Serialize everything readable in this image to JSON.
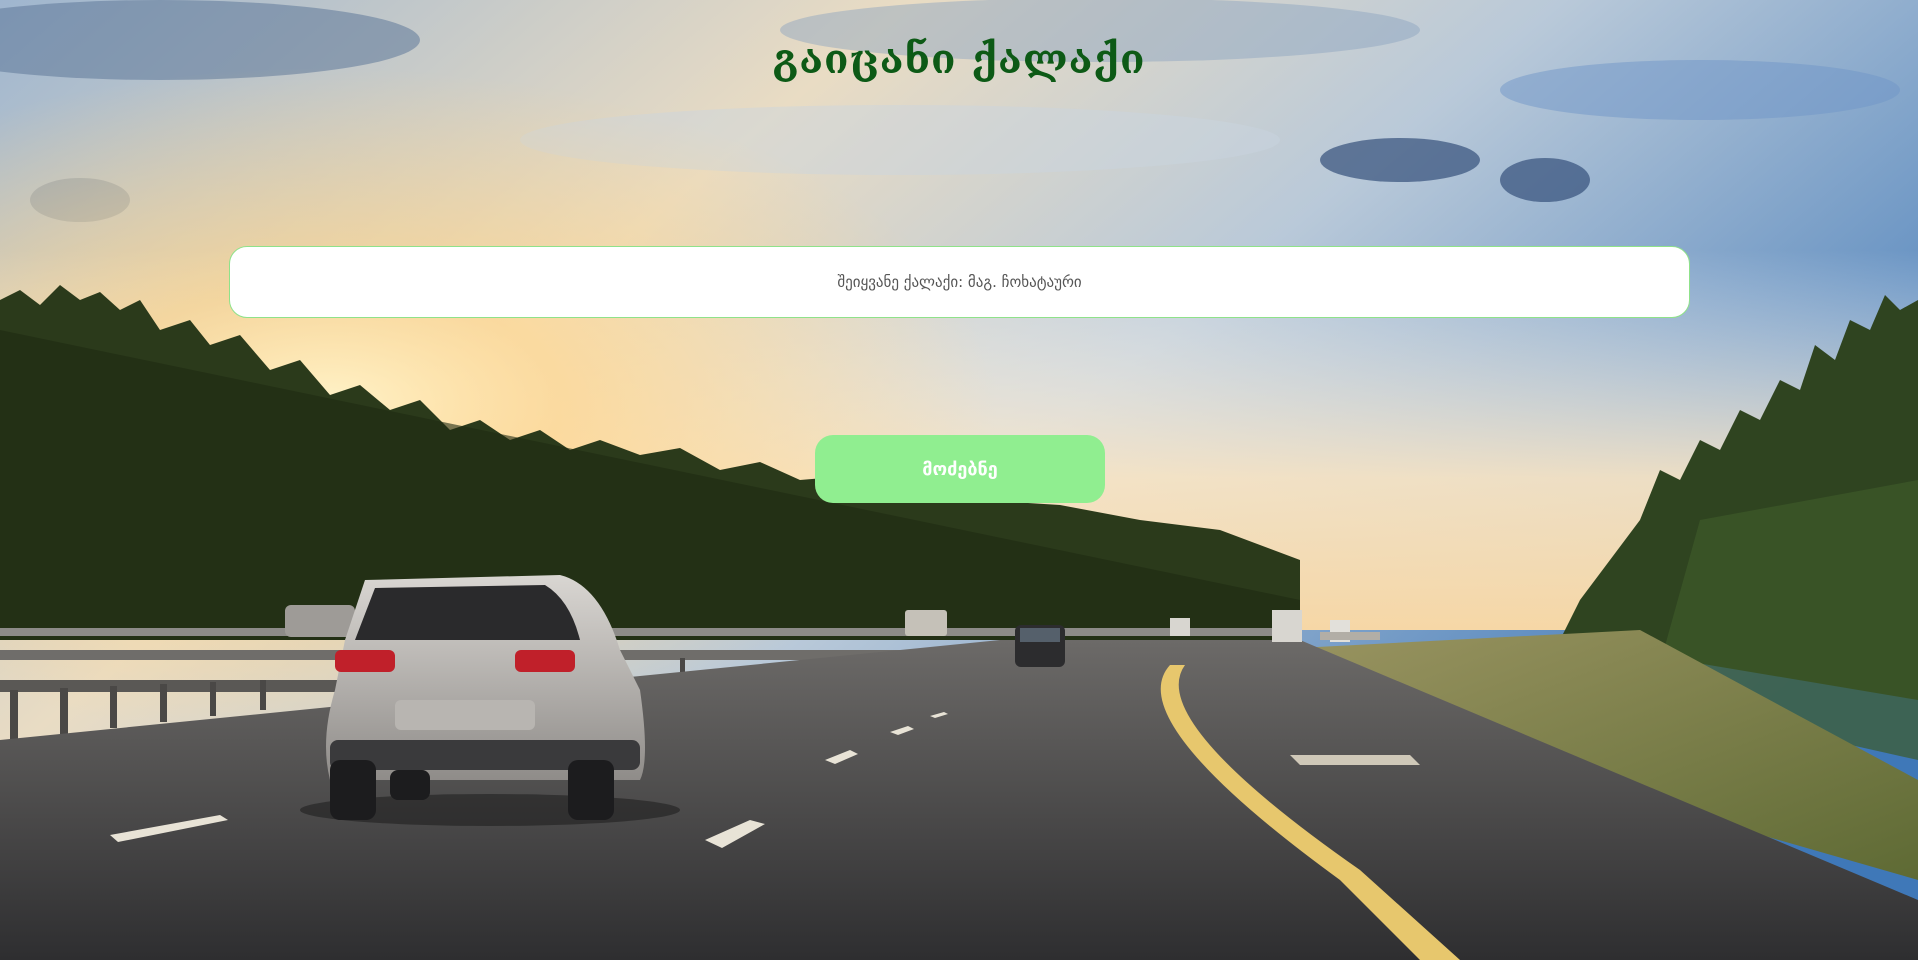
{
  "header": {
    "title": "გაიცანი ქალაქი"
  },
  "search": {
    "placeholder": "შეიყვანე ქალაქი: მაგ. ჩოხატაური",
    "value": ""
  },
  "actions": {
    "search_label": "მოძებნე"
  },
  "colors": {
    "title": "#0d5a16",
    "button_bg": "#90ee90",
    "input_border": "#8fe28a"
  }
}
